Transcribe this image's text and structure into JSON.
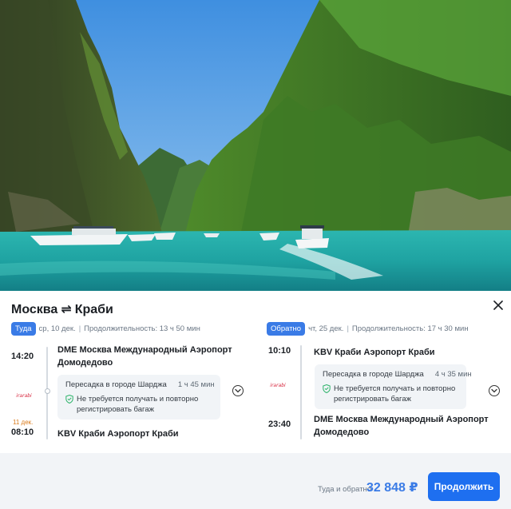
{
  "route": {
    "origin": "Москва",
    "arrows": "⇌",
    "destination": "Краби"
  },
  "icons": {
    "close": "close-icon",
    "expand": "chevron-down-icon",
    "shield": "shield-check-icon",
    "airline": "air-arabia-logo"
  },
  "colors": {
    "accent": "#3a7be6",
    "button": "#1e6ff0",
    "next_day": "#d97a1a",
    "shield": "#2db36a",
    "airline_logo": "#d7263d"
  },
  "outbound": {
    "badge": "Туда",
    "date": "ср, 10 дек.",
    "duration": "Продолжительность: 13 ч 50 мин",
    "depart_time": "14:20",
    "depart_station": "DME Москва Международный Аэропорт Домодедово",
    "transfer": "Пересадка в городе Шарджа",
    "transfer_duration": "1 ч 45 мин",
    "baggage_note": "Не требуется получать и повторно регистрировать багаж",
    "next_day": "11 дек.",
    "arrive_time": "08:10",
    "arrive_station": "KBV Краби Аэропорт Краби"
  },
  "return": {
    "badge": "Обратно",
    "date": "чт, 25 дек.",
    "duration": "Продолжительность: 17 ч 30 мин",
    "depart_time": "10:10",
    "depart_station": "KBV Краби Аэропорт Краби",
    "transfer": "Пересадка в городе Шарджа",
    "transfer_duration": "4 ч 35 мин",
    "baggage_note": "Не требуется получать и повторно регистрировать багаж",
    "arrive_time": "23:40",
    "arrive_station": "DME Москва Международный Аэропорт Домодедово"
  },
  "footer": {
    "total_label": "Туда и обратно",
    "price": "32 848 ₽",
    "continue_label": "Продолжить"
  }
}
